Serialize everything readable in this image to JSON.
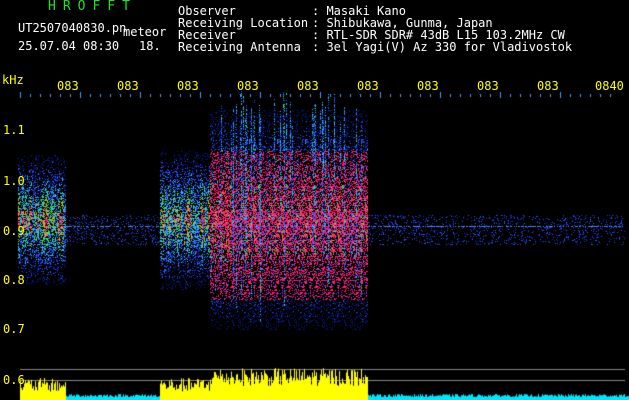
{
  "header": {
    "app_title": "HROFFT",
    "filename": "UT2507040830.pn",
    "meteor_label": "meteor",
    "datetime": "25.07.04 08:30",
    "count": "18.",
    "info": [
      {
        "label": "Observer",
        "value": ": Masaki Kano"
      },
      {
        "label": "Receiving Location",
        "value": ": Shibukawa, Gunma, Japan"
      },
      {
        "label": "Receiver",
        "value": ": RTL-SDR SDR# 43dB L15 103.2MHz CW"
      },
      {
        "label": "Receiving Antenna",
        "value": ": 3el Yagi(V) Az 330 for Vladivostok"
      }
    ]
  },
  "chart_data": {
    "type": "heatmap",
    "ylabel": "kHz",
    "y_ticks": [
      "1.1",
      "1.0",
      "0.9",
      "0.8",
      "0.7",
      "0.6"
    ],
    "x_ticks": [
      "083",
      "083",
      "083",
      "083",
      "083",
      "083",
      "083",
      "083",
      "083",
      "0840"
    ],
    "colors": {
      "background": "#000000",
      "axis_text": "#ffff00",
      "power_trace": "#ffff00",
      "noise_floor": "#00e5ff",
      "tick_marks": "#4a9dff",
      "signal_low": "#1a3cff",
      "signal_high": "#ff2070"
    }
  }
}
